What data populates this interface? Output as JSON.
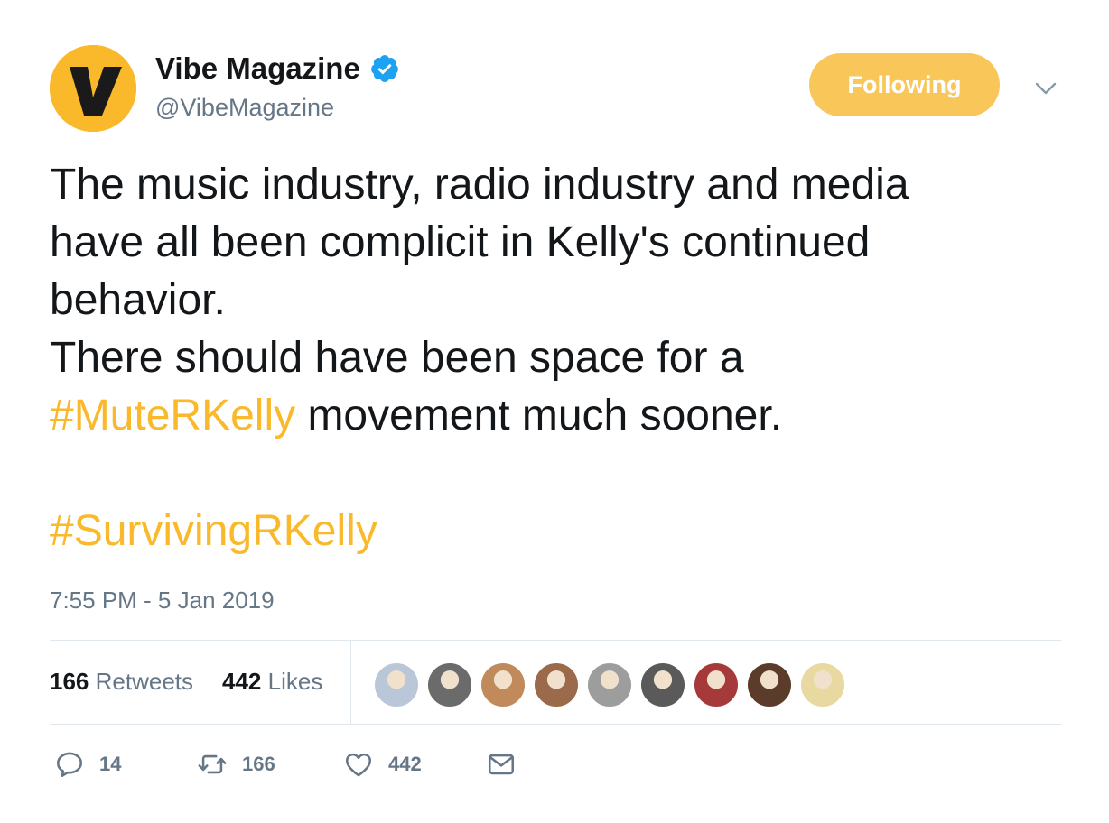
{
  "account": {
    "name": "Vibe Magazine",
    "handle": "@VibeMagazine",
    "avatar_letter": "V",
    "avatar_color": "#f9b92b",
    "verified_color": "#1da1f2"
  },
  "follow_button": {
    "label": "Following",
    "color": "#f9c65a"
  },
  "tweet": {
    "line1": "The music industry, radio industry and media",
    "line2": "have all been complicit in Kelly's continued",
    "line3": "behavior.",
    "line4": "There should have been space for a",
    "hashtag1": "#MuteRKelly",
    "line5_rest": " movement much sooner.",
    "hashtag2": "#SurvivingRKelly",
    "hashtag_color": "#f9b92b"
  },
  "timestamp": "7:55 PM - 5 Jan 2019",
  "stats": {
    "retweets_count": "166",
    "retweets_label": "Retweets",
    "likes_count": "442",
    "likes_label": "Likes"
  },
  "liker_avatars": [
    {
      "color": "#b9c7d8"
    },
    {
      "color": "#6b6b6b"
    },
    {
      "color": "#c08a5a"
    },
    {
      "color": "#9a6a4a"
    },
    {
      "color": "#9d9d9d"
    },
    {
      "color": "#5a5a5a"
    },
    {
      "color": "#a63a3a"
    },
    {
      "color": "#5b3c2a"
    },
    {
      "color": "#e8d9a0"
    }
  ],
  "actions": {
    "reply_count": "14",
    "retweet_count": "166",
    "like_count": "442",
    "icons": [
      "reply-icon",
      "retweet-icon",
      "like-icon",
      "message-icon"
    ]
  }
}
